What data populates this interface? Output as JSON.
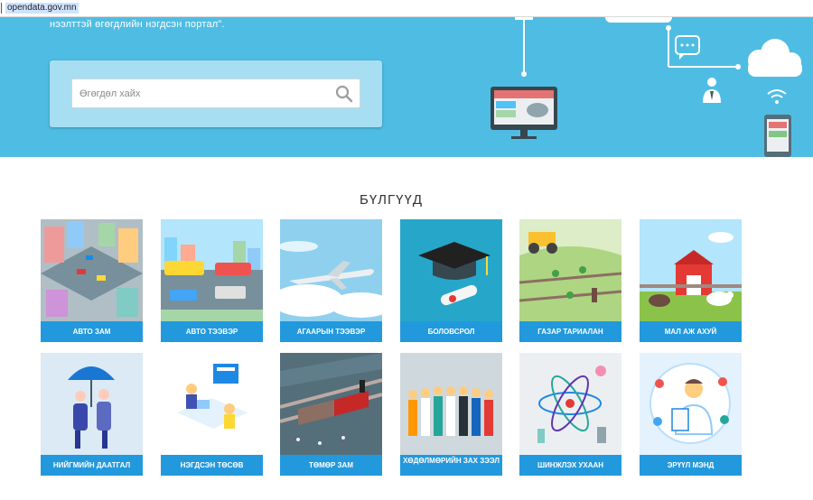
{
  "browser": {
    "url": "opendata.gov.mn"
  },
  "hero": {
    "tagline": "нээлттэй өгөгдлийн нэгдсэн портал\".",
    "search_placeholder": "Өгөгдөл хайх"
  },
  "section": {
    "title": "БҮЛГҮҮД"
  },
  "categories": [
    {
      "label": "АВТО ЗАМ"
    },
    {
      "label": "АВТО ТЭЭВЭР"
    },
    {
      "label": "АГААРЫН ТЭЭВЭР"
    },
    {
      "label": "БОЛОВСРОЛ"
    },
    {
      "label": "ГАЗАР ТАРИАЛАН"
    },
    {
      "label": "МАЛ АЖ АХУЙ"
    },
    {
      "label": "НИЙГМИЙН ДААТГАЛ"
    },
    {
      "label": "НЭГДСЭН ТӨСӨВ"
    },
    {
      "label": "ТӨМӨР ЗАМ"
    },
    {
      "label": "ХӨДӨЛМӨРИЙН ЗАХ ЗЭЭЛ"
    },
    {
      "label": "ШИНЖЛЭХ УХААН"
    },
    {
      "label": "ЭРҮҮЛ МЭНД"
    }
  ],
  "colors": {
    "hero": "#4fbde3",
    "label_bar": "#2299dd",
    "search_card": "#a7def1"
  },
  "icons": [
    "search-icon",
    "chat-icon",
    "cloud-icon",
    "user-icon",
    "wifi-icon",
    "monitor-icon",
    "phone-icon"
  ]
}
